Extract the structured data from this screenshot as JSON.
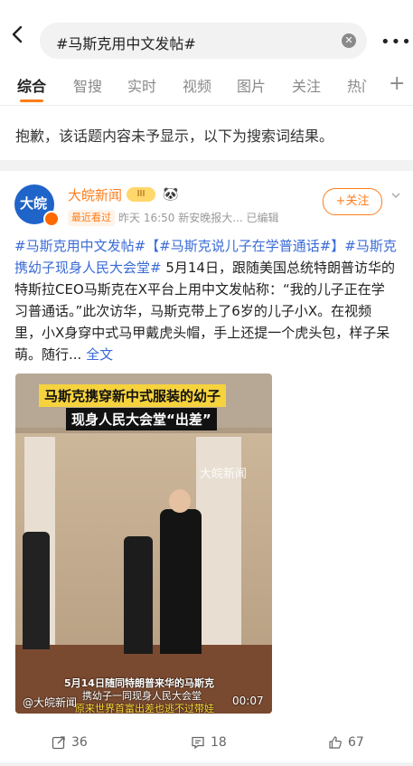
{
  "search": {
    "query": "#马斯克用中文发帖#"
  },
  "tabs": [
    "综合",
    "智搜",
    "实时",
    "视频",
    "图片",
    "关注",
    "热门"
  ],
  "notice": "抱歉，该话题内容未予显示，以下为搜索词结果。",
  "post": {
    "avatar_text": "大皖",
    "author": "大皖新闻",
    "badge": "III",
    "meta_tag": "最近看过",
    "meta": "昨天 16:50  新安晚报大...  已编辑",
    "follow": "+关注",
    "content": {
      "tag1": "#马斯克用中文发帖#",
      "tag2": "【#马斯克说儿子在学普通话#】",
      "tag3": "#马斯克携幼子现身人民大会堂#",
      "body": " 5月14日，跟随美国总统特朗普访华的特斯拉CEO马斯克在X平台上用中文发帖称：“我的儿子正在学习普通话。”此次访华，马斯克带上了6岁的儿子小X。在视频里，小X身穿中式马甲戴虎头帽，手上还提一个虎头包，样子呆萌。随行...",
      "fulltext": "全文"
    },
    "video": {
      "title1": "马斯克携穿新中式服装的幼子",
      "title2": "现身人民大会堂“出差”",
      "watermark": "大皖新闻",
      "sub1": "5月14日随同特朗普来华的马斯克",
      "sub2": "携幼子一同现身人民大会堂",
      "sub3": "原来世界首富出差也逃不过带娃",
      "source": "@大皖新闻",
      "duration": "00:07"
    },
    "actions": {
      "shares": "36",
      "comments": "18",
      "likes": "67"
    }
  }
}
